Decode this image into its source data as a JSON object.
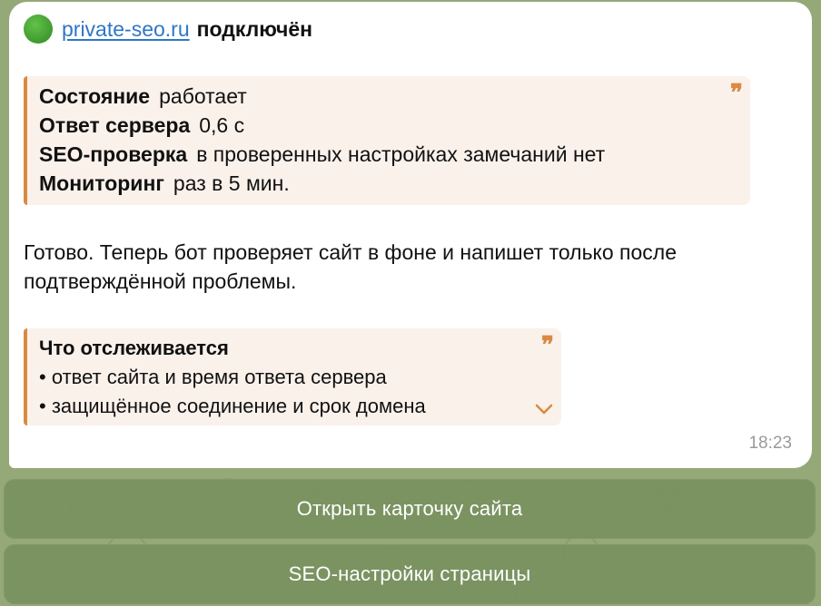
{
  "header": {
    "status_icon": "green-circle",
    "site": "private-seo.ru",
    "status": "подключён"
  },
  "summary": {
    "rows": [
      {
        "label": "Состояние",
        "value": "работает"
      },
      {
        "label": "Ответ сервера",
        "value": "0,6 с"
      },
      {
        "label": "SEO-проверка",
        "value": "в проверенных настройках замечаний нет"
      },
      {
        "label": "Мониторинг",
        "value": "раз в 5 мин."
      }
    ]
  },
  "message": {
    "text": "Готово. Теперь бот проверяет сайт в фоне и напишет только после подтверждённой проблемы."
  },
  "tracking": {
    "title": "Что отслеживается",
    "items": [
      "• ответ сайта и время ответа сервера",
      "• защищённое соединение и срок домена"
    ]
  },
  "time": "18:23",
  "buttons": {
    "open_card": "Открыть карточку сайта",
    "seo_settings": "SEO-настройки страницы"
  },
  "colors": {
    "accent_quote": "#d98a43",
    "link": "#2f76c6",
    "button_bg": "#7c9460",
    "status_green": "#3f9a2f"
  }
}
